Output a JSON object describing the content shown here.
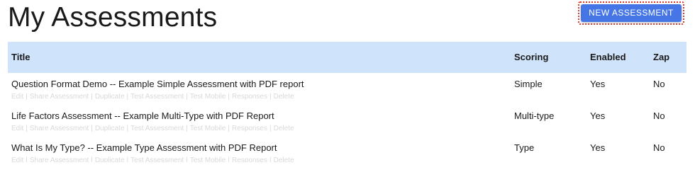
{
  "header": {
    "title": "My Assessments",
    "new_button_label": "NEW ASSESSMENT"
  },
  "colors": {
    "accent": "#4676e6",
    "header_bg": "#cfe3fb",
    "highlight_border": "#d63a2a"
  },
  "table": {
    "columns": {
      "title": "Title",
      "scoring": "Scoring",
      "enabled": "Enabled",
      "zap": "Zap"
    },
    "actions": [
      "Edit",
      "Share Assessment",
      "Duplicate",
      "Test Assessment",
      "Test Mobile",
      "Responses",
      "Delete"
    ],
    "rows": [
      {
        "title": "Question Format Demo -- Example Simple Assessment with PDF report",
        "scoring": "Simple",
        "enabled": "Yes",
        "zap": "No"
      },
      {
        "title": "Life Factors Assessment -- Example Multi-Type with PDF Report",
        "scoring": "Multi-type",
        "enabled": "Yes",
        "zap": "No"
      },
      {
        "title": "What Is My Type? -- Example Type Assessment with PDF Report",
        "scoring": "Type",
        "enabled": "Yes",
        "zap": "No"
      }
    ]
  }
}
